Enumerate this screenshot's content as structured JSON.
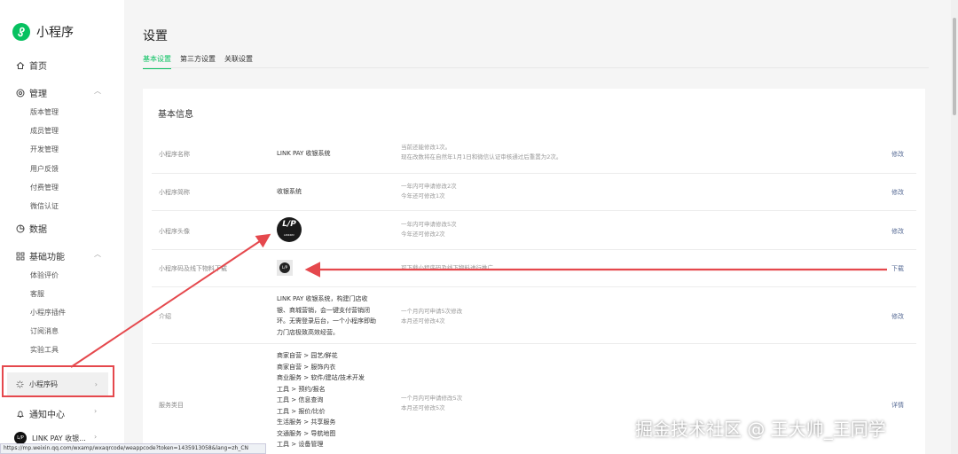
{
  "app": {
    "name": "小程序"
  },
  "nav": {
    "home": "首页",
    "manage": "管理",
    "manage_items": [
      "版本管理",
      "成员管理",
      "开发管理",
      "用户反馈",
      "付费管理",
      "微信认证"
    ],
    "data": "数据",
    "basic": "基础功能",
    "basic_items": [
      "体验评价",
      "客服",
      "小程序插件",
      "订阅消息",
      "实验工具"
    ],
    "qrcode": "小程序码",
    "notify": "通知中心",
    "account": "LINK PAY 收银...",
    "account_avatar": "L/P"
  },
  "page": {
    "title": "设置",
    "tabs": [
      "基本设置",
      "第三方设置",
      "关联设置"
    ]
  },
  "card": {
    "title": "基本信息",
    "rows": [
      {
        "label": "小程序名称",
        "value": "LINK PAY 收银系统",
        "note1": "当前还能修改1次。",
        "note2": "现在改数将在自然年1月1日和微信认证审核通过后重置为2次。",
        "action": "修改"
      },
      {
        "label": "小程序简称",
        "value": "收银系统",
        "note1": "一年内可申请修改2次",
        "note2": "今年还可修改1次",
        "action": "修改"
      },
      {
        "label": "小程序头像",
        "avatar_big": "L/P",
        "avatar_small": "LINKPAY",
        "note1": "一年内可申请修改5次",
        "note2": "今年还可修改2次",
        "action": "修改"
      },
      {
        "label": "小程序码及线下物料下载",
        "qr_text": "L/P",
        "note1": "可下载小程序码及线下物料进行推广",
        "action": "下载"
      },
      {
        "label": "介绍",
        "lines": [
          "LINK PAY 收银系统，构建门店收",
          "银、商城营销，会一键支付营销闭",
          "环。无需登录后台，一个小程序即助",
          "力门店极致高效经营。"
        ],
        "note1": "一个月内可申请5次修改",
        "note2": "本月还可修改4次",
        "action": "修改"
      },
      {
        "label": "服务类目",
        "lines": [
          "商家自营 > 园艺/鲜花",
          "商家自营 > 服饰内衣",
          "商业服务 > 软件/建站/技术开发",
          "工具 > 预约/报名",
          "工具 > 信息查询",
          "工具 > 报价/比价",
          "生活服务 > 共享服务",
          "交通服务 > 导航地图",
          "工具 > 设备管理"
        ],
        "note1": "一个月内可申请修改5次",
        "note2": "本月还可修改5次",
        "action": "详情"
      }
    ]
  },
  "status_url": "https://mp.weixin.qq.com/wxamp/wxaqrcode/weappcode?token=1435913058&lang=zh_CN",
  "watermark": "掘金技术社区 @ 王大帅_王同学",
  "colors": {
    "brand": "#07c160",
    "annotation": "#e5484d",
    "link": "#576b95"
  }
}
